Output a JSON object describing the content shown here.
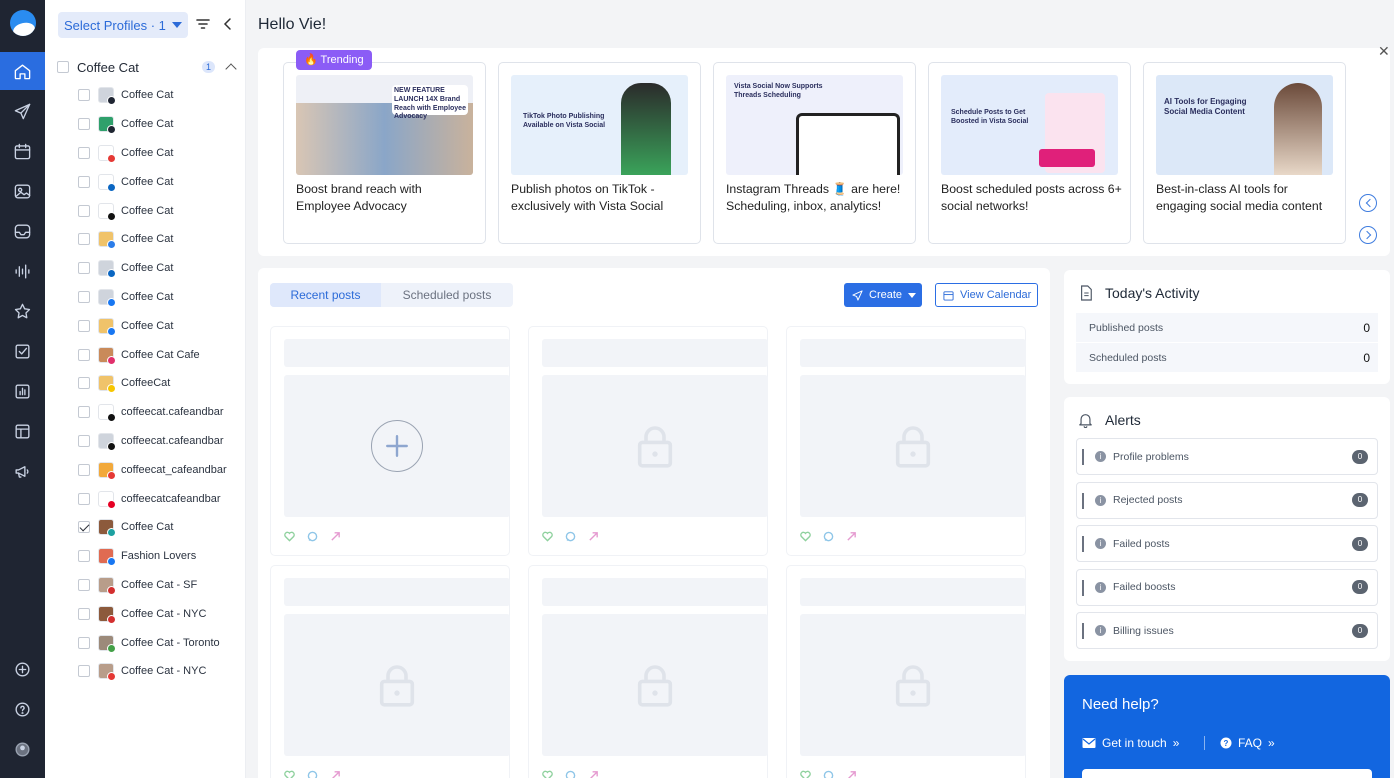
{
  "greeting": "Hello Vie!",
  "profile_selector": {
    "label": "Select Profiles · 1"
  },
  "profile_group": {
    "name": "Coffee Cat",
    "count": "1"
  },
  "profiles": [
    {
      "name": "Coffee Cat",
      "checked": false,
      "avatar": "#cfd4dc",
      "network": "#1f2532"
    },
    {
      "name": "Coffee Cat",
      "checked": false,
      "avatar": "#2fa06b",
      "network": "#1f2532"
    },
    {
      "name": "Coffee Cat",
      "checked": false,
      "avatar": "#ffffff",
      "network": "#e53935"
    },
    {
      "name": "Coffee Cat",
      "checked": false,
      "avatar": "#ffffff",
      "network": "#0a66c2"
    },
    {
      "name": "Coffee Cat",
      "checked": false,
      "avatar": "#ffffff",
      "network": "#111111"
    },
    {
      "name": "Coffee Cat",
      "checked": false,
      "avatar": "#f0c36a",
      "network": "#2b7de9"
    },
    {
      "name": "Coffee Cat",
      "checked": false,
      "avatar": "#cfd4dc",
      "network": "#0a66c2"
    },
    {
      "name": "Coffee Cat",
      "checked": false,
      "avatar": "#cfd4dc",
      "network": "#1877f2"
    },
    {
      "name": "Coffee Cat",
      "checked": false,
      "avatar": "#f0c36a",
      "network": "#1877f2"
    },
    {
      "name": "Coffee Cat Cafe",
      "checked": false,
      "avatar": "#c98a5a",
      "network": "#e1306c"
    },
    {
      "name": "CoffeeCat",
      "checked": false,
      "avatar": "#f0c36a",
      "network": "#f7c600"
    },
    {
      "name": "coffeecat.cafeandbar",
      "checked": false,
      "avatar": "#ffffff",
      "network": "#111111"
    },
    {
      "name": "coffeecat.cafeandbar",
      "checked": false,
      "avatar": "#cfd4dc",
      "network": "#111111"
    },
    {
      "name": "coffeecat_cafeandbar",
      "checked": false,
      "avatar": "#f2a93b",
      "network": "#e53935"
    },
    {
      "name": "coffeecatcafeandbar",
      "checked": false,
      "avatar": "#ffffff",
      "network": "#e60023"
    },
    {
      "name": "Coffee Cat",
      "checked": true,
      "avatar": "#8c5a3c",
      "network": "#1da1a1"
    },
    {
      "name": "Fashion Lovers",
      "checked": false,
      "avatar": "#e06b52",
      "network": "#1877f2"
    },
    {
      "name": "Coffee Cat - SF",
      "checked": false,
      "avatar": "#b89d8a",
      "network": "#d32f2f"
    },
    {
      "name": "Coffee Cat - NYC",
      "checked": false,
      "avatar": "#8c5a3c",
      "network": "#d32f2f"
    },
    {
      "name": "Coffee Cat - Toronto",
      "checked": false,
      "avatar": "#9c8a7a",
      "network": "#43a047"
    },
    {
      "name": "Coffee Cat - NYC",
      "checked": false,
      "avatar": "#b89d8a",
      "network": "#e53935"
    }
  ],
  "trending": {
    "badge": "🔥 Trending",
    "cards": [
      {
        "caption": "Boost brand reach with Employee Advocacy",
        "thumb_text": "NEW FEATURE LAUNCH 14X Brand Reach with Employee Advocacy",
        "bg": "#eef0f6"
      },
      {
        "caption": "Publish photos on TikTok - exclusively with Vista Social",
        "thumb_text": "TikTok Photo Publishing Available on Vista Social",
        "bg": "#e6f0fb"
      },
      {
        "caption": "Instagram Threads 🧵 are here! Scheduling, inbox, analytics!",
        "thumb_text": "Vista Social Now Supports Threads Scheduling",
        "bg": "#eef0fb"
      },
      {
        "caption": "Boost scheduled posts across 6+ social networks!",
        "thumb_text": "Schedule Posts to Get Boosted in Vista Social",
        "bg": "#e3ecfb"
      },
      {
        "caption": "Best-in-class AI tools for engaging social media content",
        "thumb_text": "AI Tools for Engaging Social Media Content",
        "bg": "#dce8f8"
      }
    ]
  },
  "posts": {
    "tabs": [
      "Recent posts",
      "Scheduled posts"
    ],
    "create_label": "Create",
    "calendar_label": "View Calendar"
  },
  "activity": {
    "title": "Today's Activity",
    "rows": [
      {
        "label": "Published posts",
        "value": "0"
      },
      {
        "label": "Scheduled posts",
        "value": "0"
      }
    ]
  },
  "alerts": {
    "title": "Alerts",
    "rows": [
      {
        "label": "Profile problems",
        "count": "0"
      },
      {
        "label": "Rejected posts",
        "count": "0"
      },
      {
        "label": "Failed posts",
        "count": "0"
      },
      {
        "label": "Failed boosts",
        "count": "0"
      },
      {
        "label": "Billing issues",
        "count": "0"
      }
    ]
  },
  "help": {
    "title": "Need help?",
    "contact_label": "Get in touch",
    "faq_label": "FAQ"
  },
  "colors": {
    "accent": "#2b6ee4",
    "rail": "#1f2532",
    "trending": "#8b5cf6",
    "help_bg": "#1266e0"
  }
}
